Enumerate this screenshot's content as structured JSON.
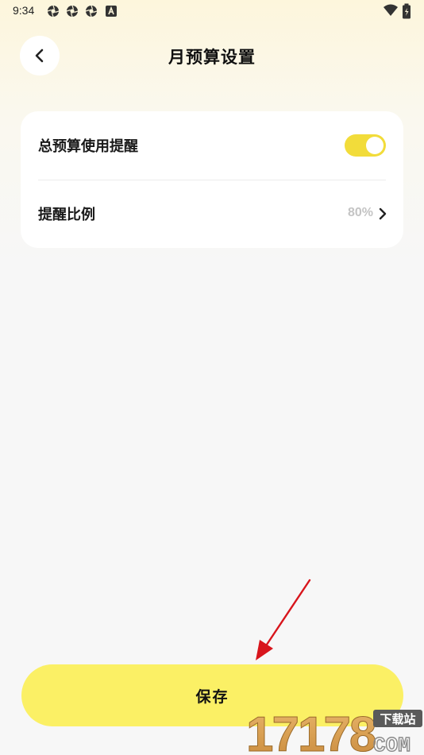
{
  "status_bar": {
    "time": "9:34",
    "icons": [
      "aperture-icon",
      "aperture-icon",
      "aperture-icon",
      "a-badge-icon",
      "wifi-icon",
      "battery-icon"
    ]
  },
  "header": {
    "title": "月预算设置",
    "back_icon": "chevron-left-icon"
  },
  "settings": {
    "reminder_toggle": {
      "label": "总预算使用提醒",
      "enabled": true
    },
    "reminder_ratio": {
      "label": "提醒比例",
      "value": "80%"
    }
  },
  "footer": {
    "save_label": "保存"
  },
  "watermark": {
    "digits": "17178",
    "tag": "下载站",
    "suffix": "COM"
  },
  "colors": {
    "accent": "#fbf065",
    "toggle_on": "#f2dc3a",
    "annotation": "#d8151c"
  }
}
